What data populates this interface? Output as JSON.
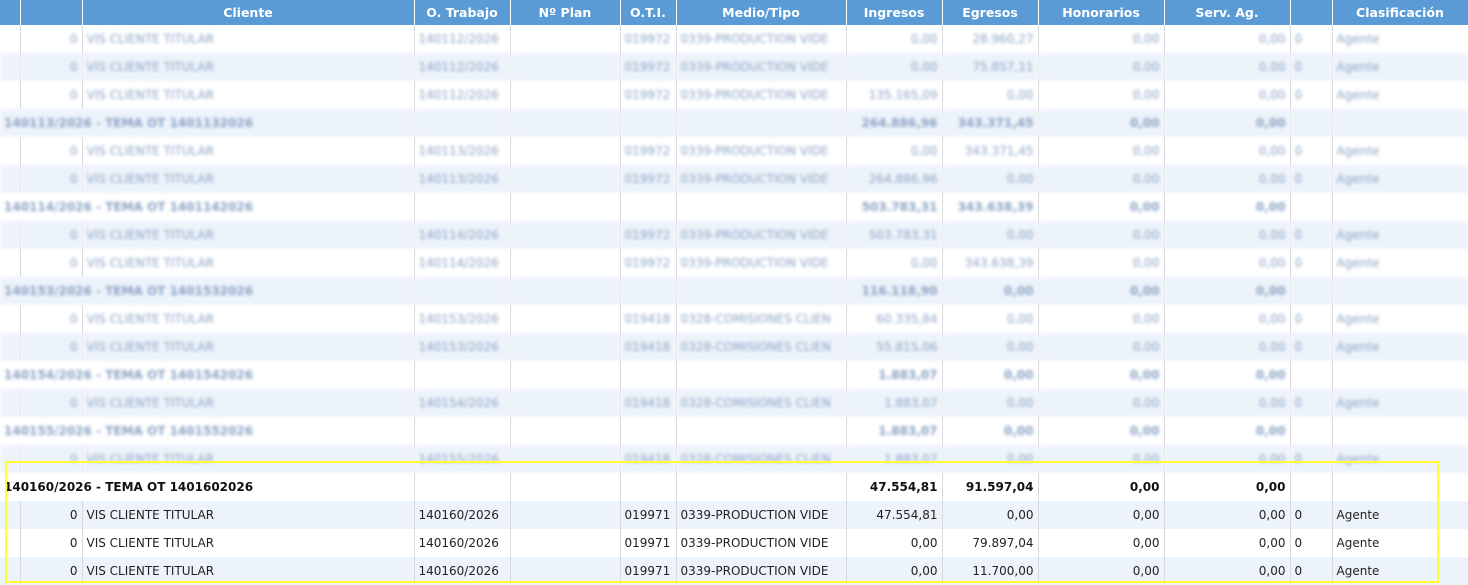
{
  "columns": [
    "",
    "",
    "Cliente",
    "O. Trabajo",
    "Nº Plan",
    "O.T.I.",
    "Medio/Tipo",
    "Ingresos",
    "Egresos",
    "Honorarios",
    "Serv. Ag.",
    "",
    "Clasificación"
  ],
  "rows": [
    {
      "type": "detail",
      "blur": true,
      "idx": "0",
      "cliente": "VIS CLIENTE TITULAR",
      "ot": "140112/2026",
      "plan": "",
      "oti": "019972",
      "medio": "0339-PRODUCTION VIDE",
      "ingresos": "0,00",
      "egresos": "28.960,27",
      "honorarios": "0,00",
      "serv": "0,00",
      "x": "0",
      "clas": "Agente"
    },
    {
      "type": "detail",
      "blur": true,
      "idx": "0",
      "cliente": "VIS CLIENTE TITULAR",
      "ot": "140112/2026",
      "plan": "",
      "oti": "019972",
      "medio": "0339-PRODUCTION VIDE",
      "ingresos": "0,00",
      "egresos": "75.857,11",
      "honorarios": "0,00",
      "serv": "0,00",
      "x": "0",
      "clas": "Agente"
    },
    {
      "type": "detail",
      "blur": true,
      "idx": "0",
      "cliente": "VIS CLIENTE TITULAR",
      "ot": "140112/2026",
      "plan": "",
      "oti": "019972",
      "medio": "0339-PRODUCTION VIDE",
      "ingresos": "135.165,09",
      "egresos": "0,00",
      "honorarios": "0,00",
      "serv": "0,00",
      "x": "0",
      "clas": "Agente"
    },
    {
      "type": "group",
      "blur": true,
      "title": "140113/2026 - TEMA OT 1401132026",
      "ingresos": "264.886,96",
      "egresos": "343.371,45",
      "honorarios": "0,00",
      "serv": "0,00"
    },
    {
      "type": "detail",
      "blur": true,
      "idx": "0",
      "cliente": "VIS CLIENTE TITULAR",
      "ot": "140113/2026",
      "plan": "",
      "oti": "019972",
      "medio": "0339-PRODUCTION VIDE",
      "ingresos": "0,00",
      "egresos": "343.371,45",
      "honorarios": "0,00",
      "serv": "0,00",
      "x": "0",
      "clas": "Agente"
    },
    {
      "type": "detail",
      "blur": true,
      "idx": "0",
      "cliente": "VIS CLIENTE TITULAR",
      "ot": "140113/2026",
      "plan": "",
      "oti": "019972",
      "medio": "0339-PRODUCTION VIDE",
      "ingresos": "264.886,96",
      "egresos": "0,00",
      "honorarios": "0,00",
      "serv": "0,00",
      "x": "0",
      "clas": "Agente"
    },
    {
      "type": "group",
      "blur": true,
      "title": "140114/2026 - TEMA OT 1401142026",
      "ingresos": "503.783,31",
      "egresos": "343.638,39",
      "honorarios": "0,00",
      "serv": "0,00"
    },
    {
      "type": "detail",
      "blur": true,
      "idx": "0",
      "cliente": "VIS CLIENTE TITULAR",
      "ot": "140114/2026",
      "plan": "",
      "oti": "019972",
      "medio": "0339-PRODUCTION VIDE",
      "ingresos": "503.783,31",
      "egresos": "0,00",
      "honorarios": "0,00",
      "serv": "0,00",
      "x": "0",
      "clas": "Agente"
    },
    {
      "type": "detail",
      "blur": true,
      "idx": "0",
      "cliente": "VIS CLIENTE TITULAR",
      "ot": "140114/2026",
      "plan": "",
      "oti": "019972",
      "medio": "0339-PRODUCTION VIDE",
      "ingresos": "0,00",
      "egresos": "343.638,39",
      "honorarios": "0,00",
      "serv": "0,00",
      "x": "0",
      "clas": "Agente"
    },
    {
      "type": "group",
      "blur": true,
      "title": "140153/2026 - TEMA OT 1401532026",
      "ingresos": "116.118,90",
      "egresos": "0,00",
      "honorarios": "0,00",
      "serv": "0,00"
    },
    {
      "type": "detail",
      "blur": true,
      "idx": "0",
      "cliente": "VIS CLIENTE TITULAR",
      "ot": "140153/2026",
      "plan": "",
      "oti": "019418",
      "medio": "0328-COMISIONES CLIEN",
      "ingresos": "60.335,84",
      "egresos": "0,00",
      "honorarios": "0,00",
      "serv": "0,00",
      "x": "0",
      "clas": "Agente"
    },
    {
      "type": "detail",
      "blur": true,
      "idx": "0",
      "cliente": "VIS CLIENTE TITULAR",
      "ot": "140153/2026",
      "plan": "",
      "oti": "019418",
      "medio": "0328-COMISIONES CLIEN",
      "ingresos": "55.815,06",
      "egresos": "0,00",
      "honorarios": "0,00",
      "serv": "0,00",
      "x": "0",
      "clas": "Agente"
    },
    {
      "type": "group",
      "blur": true,
      "title": "140154/2026 - TEMA OT 1401542026",
      "ingresos": "1.883,07",
      "egresos": "0,00",
      "honorarios": "0,00",
      "serv": "0,00"
    },
    {
      "type": "detail",
      "blur": true,
      "idx": "0",
      "cliente": "VIS CLIENTE TITULAR",
      "ot": "140154/2026",
      "plan": "",
      "oti": "019418",
      "medio": "0328-COMISIONES CLIEN",
      "ingresos": "1.883,07",
      "egresos": "0,00",
      "honorarios": "0,00",
      "serv": "0,00",
      "x": "0",
      "clas": "Agente"
    },
    {
      "type": "group",
      "blur": true,
      "title": "140155/2026 - TEMA OT 1401552026",
      "ingresos": "1.883,07",
      "egresos": "0,00",
      "honorarios": "0,00",
      "serv": "0,00"
    },
    {
      "type": "detail",
      "blur": true,
      "idx": "0",
      "cliente": "VIS CLIENTE TITULAR",
      "ot": "140155/2026",
      "plan": "",
      "oti": "019418",
      "medio": "0328-COMISIONES CLIEN",
      "ingresos": "1.883,07",
      "egresos": "0,00",
      "honorarios": "0,00",
      "serv": "0,00",
      "x": "0",
      "clas": "Agente"
    },
    {
      "type": "group",
      "blur": false,
      "title": "140160/2026 - TEMA OT 1401602026",
      "ingresos": "47.554,81",
      "egresos": "91.597,04",
      "honorarios": "0,00",
      "serv": "0,00"
    },
    {
      "type": "detail",
      "blur": false,
      "idx": "0",
      "cliente": "VIS CLIENTE TITULAR",
      "ot": "140160/2026",
      "plan": "",
      "oti": "019971",
      "medio": "0339-PRODUCTION VIDE",
      "ingresos": "47.554,81",
      "egresos": "0,00",
      "honorarios": "0,00",
      "serv": "0,00",
      "x": "0",
      "clas": "Agente"
    },
    {
      "type": "detail",
      "blur": false,
      "idx": "0",
      "cliente": "VIS CLIENTE TITULAR",
      "ot": "140160/2026",
      "plan": "",
      "oti": "019971",
      "medio": "0339-PRODUCTION VIDE",
      "ingresos": "0,00",
      "egresos": "79.897,04",
      "honorarios": "0,00",
      "serv": "0,00",
      "x": "0",
      "clas": "Agente"
    },
    {
      "type": "detail",
      "blur": false,
      "idx": "0",
      "cliente": "VIS CLIENTE TITULAR",
      "ot": "140160/2026",
      "plan": "",
      "oti": "019971",
      "medio": "0339-PRODUCTION VIDE",
      "ingresos": "0,00",
      "egresos": "11.700,00",
      "honorarios": "0,00",
      "serv": "0,00",
      "x": "0",
      "clas": "Agente"
    }
  ]
}
